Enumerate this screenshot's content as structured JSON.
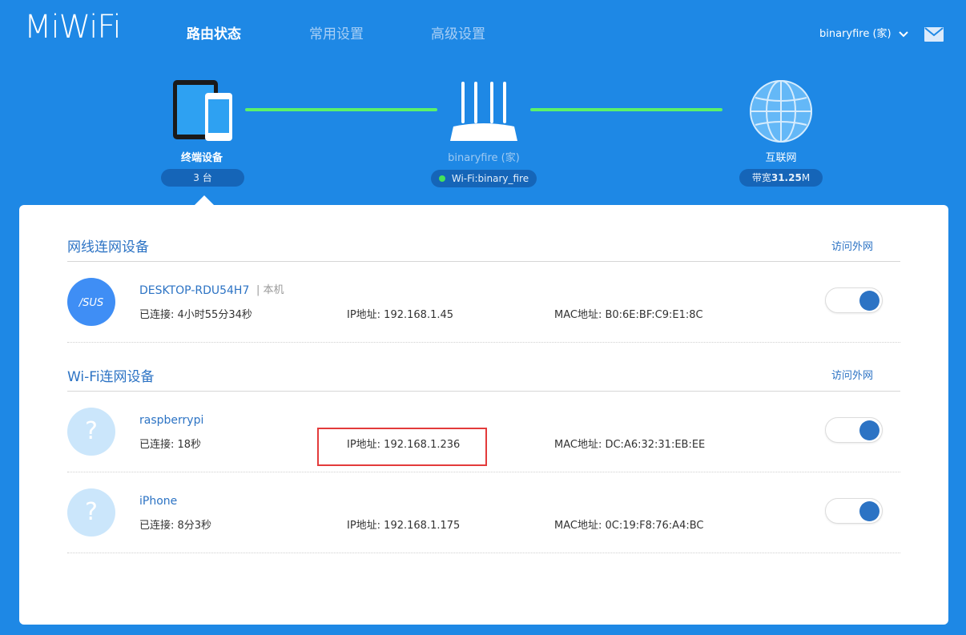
{
  "header": {
    "logo": "MiWiFi",
    "nav": [
      "路由状态",
      "常用设置",
      "高级设置"
    ],
    "user": "binaryfire (家)"
  },
  "topology": {
    "terminal": {
      "label": "终端设备",
      "count": "3 台"
    },
    "router": {
      "label": "binaryfire (家)",
      "wifi": "Wi-Fi:binary_fire"
    },
    "internet": {
      "label": "互联网",
      "bandwidth_prefix": "带宽",
      "bandwidth_value": "31.25",
      "bandwidth_unit": "M"
    }
  },
  "sections": {
    "wired": {
      "title": "网线连网设备",
      "access": "访问外网",
      "devices": [
        {
          "name": "DESKTOP-RDU54H7",
          "tag": "| 本机",
          "connected": "已连接: 4小时55分34秒",
          "ip": "IP地址: 192.168.1.45",
          "mac": "MAC地址: B0:6E:BF:C9:E1:8C",
          "avatar_text": "/SUS"
        }
      ]
    },
    "wifi": {
      "title": "Wi-Fi连网设备",
      "access": "访问外网",
      "devices": [
        {
          "name": "raspberrypi",
          "connected": "已连接: 18秒",
          "ip": "IP地址: 192.168.1.236",
          "mac": "MAC地址: DC:A6:32:31:EB:EE",
          "avatar_text": "?"
        },
        {
          "name": "iPhone",
          "connected": "已连接: 8分3秒",
          "ip": "IP地址: 192.168.1.175",
          "mac": "MAC地址: 0C:19:F8:76:A4:BC",
          "avatar_text": "?"
        }
      ]
    }
  }
}
